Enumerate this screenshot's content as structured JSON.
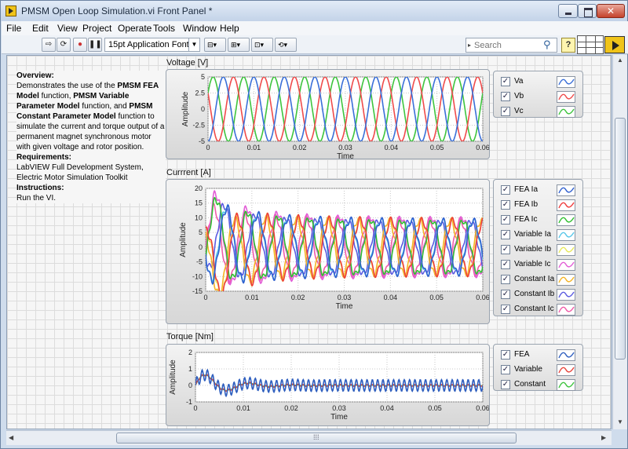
{
  "window": {
    "title": "PMSM Open Loop Simulation.vi Front Panel *"
  },
  "menu": [
    "File",
    "Edit",
    "View",
    "Project",
    "Operate",
    "Tools",
    "Window",
    "Help"
  ],
  "toolbar": {
    "font": "15pt Application Font",
    "search_placeholder": "Search",
    "help_label": "?"
  },
  "overview": {
    "heading": "Overview:",
    "p1": "Demonstrates the use of the ",
    "b1": "PMSM FEA Model",
    "p2": " function, ",
    "b2": "PMSM Variable Parameter Model",
    "p3": " function, and ",
    "b3": "PMSM Constant Parameter Model",
    "p4": " function to simulate the current and torque output of a permanent magnet synchronous motor with given voltage and rotor position.",
    "req_heading": "Requirements:",
    "req_text": "LabVIEW Full Development System, Electric Motor Simulation Toolkit",
    "instr_heading": "Instructions:",
    "instr_text": "Run the VI."
  },
  "colors": {
    "grid": "#c8c8c8",
    "plot_bg": "#ffffff"
  },
  "chart_data": [
    {
      "type": "line",
      "title": "Voltage [V]",
      "xlabel": "Time",
      "ylabel": "Amplitude",
      "xlim": [
        0,
        0.06
      ],
      "ylim": [
        -5,
        5
      ],
      "x_ticks": [
        "0",
        "0.01",
        "0.02",
        "0.03",
        "0.04",
        "0.05",
        "0.06"
      ],
      "y_ticks": [
        "5",
        "2.5",
        "0",
        "-2.5",
        "-5"
      ],
      "series": [
        {
          "name": "Va",
          "color": "#3a6fd8",
          "amplitude": 5,
          "frequency_hz": 150,
          "phase_deg": -90
        },
        {
          "name": "Vb",
          "color": "#ef4b4b",
          "amplitude": 5,
          "frequency_hz": 150,
          "phase_deg": 150
        },
        {
          "name": "Vc",
          "color": "#3ec43e",
          "amplitude": 5,
          "frequency_hz": 150,
          "phase_deg": 30
        }
      ]
    },
    {
      "type": "line",
      "title": "Currrent [A]",
      "xlabel": "Time",
      "ylabel": "Amplitude",
      "xlim": [
        0,
        0.06
      ],
      "ylim": [
        -15,
        20
      ],
      "x_ticks": [
        "0",
        "0.01",
        "0.02",
        "0.03",
        "0.04",
        "0.05",
        "0.06"
      ],
      "y_ticks": [
        "20",
        "15",
        "10",
        "5",
        "0",
        "-5",
        "-10",
        "-15"
      ],
      "series": [
        {
          "name": "FEA Ia",
          "color": "#2f5fcf",
          "amplitude": 9,
          "frequency_hz": 150,
          "phase_deg": 200,
          "dc": 0,
          "transient": 5
        },
        {
          "name": "FEA Ib",
          "color": "#ef3b3b",
          "amplitude": 9,
          "frequency_hz": 150,
          "phase_deg": 80,
          "dc": 0,
          "transient": 5
        },
        {
          "name": "FEA Ic",
          "color": "#2fbf2f",
          "amplitude": 9,
          "frequency_hz": 150,
          "phase_deg": -40,
          "dc": 0,
          "transient": 5
        },
        {
          "name": "Variable Ia",
          "color": "#57c6e8",
          "amplitude": 9,
          "frequency_hz": 150,
          "phase_deg": 205,
          "dc": 0,
          "transient": 5
        },
        {
          "name": "Variable Ib",
          "color": "#e8e85a",
          "amplitude": 9,
          "frequency_hz": 150,
          "phase_deg": 85,
          "dc": 0,
          "transient": 5
        },
        {
          "name": "Variable Ic",
          "color": "#e25ed6",
          "amplitude": 10,
          "frequency_hz": 150,
          "phase_deg": -35,
          "dc": 0,
          "transient": 6
        },
        {
          "name": "Constant Ia",
          "color": "#f5b324",
          "amplitude": 9,
          "frequency_hz": 150,
          "phase_deg": 110,
          "dc": 0,
          "transient": 4
        },
        {
          "name": "Constant Ib",
          "color": "#5b5be0",
          "amplitude": 9,
          "frequency_hz": 150,
          "phase_deg": 230,
          "dc": 0,
          "transient": 4
        },
        {
          "name": "Constant Ic",
          "color": "#f05aa8",
          "amplitude": 9,
          "frequency_hz": 150,
          "phase_deg": -10,
          "dc": 0,
          "transient": 4
        }
      ]
    },
    {
      "type": "line",
      "title": "Torque [Nm]",
      "xlabel": "Time",
      "ylabel": "Amplitude",
      "xlim": [
        0,
        0.06
      ],
      "ylim": [
        -1,
        2
      ],
      "x_ticks": [
        "0",
        "0.01",
        "0.02",
        "0.03",
        "0.04",
        "0.05",
        "0.06"
      ],
      "y_ticks": [
        "2",
        "1",
        "0",
        "-1"
      ],
      "series": [
        {
          "name": "FEA",
          "color": "#2f5fbf",
          "ripple": 0.35,
          "ripple_hz": 900
        },
        {
          "name": "Variable",
          "color": "#e8453c",
          "ripple": 0.05,
          "ripple_hz": 900
        },
        {
          "name": "Constant",
          "color": "#3ec43e",
          "ripple": 0.02,
          "ripple_hz": 900
        }
      ]
    }
  ]
}
